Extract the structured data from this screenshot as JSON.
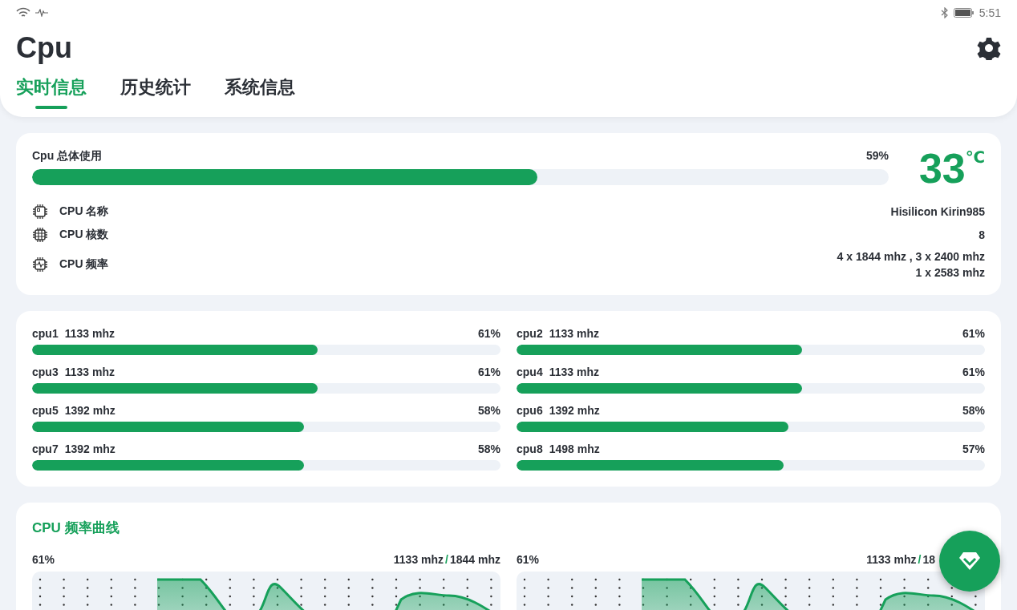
{
  "status_bar": {
    "time": "5:51"
  },
  "header": {
    "title": "Cpu"
  },
  "tabs": [
    {
      "label": "实时信息",
      "selected": true
    },
    {
      "label": "历史统计",
      "selected": false
    },
    {
      "label": "系统信息",
      "selected": false
    }
  ],
  "overview": {
    "usage_label": "Cpu 总体使用",
    "usage_reading": "59%",
    "level": 0.59,
    "temperature": "33",
    "temperature_unit": "℃",
    "info": [
      {
        "kind": "chip",
        "label": "CPU 名称",
        "values": [
          "Hisilicon Kirin985"
        ]
      },
      {
        "kind": "grid",
        "label": "CPU 核数",
        "values": [
          "8"
        ]
      },
      {
        "kind": "pulse",
        "label": "CPU 频率",
        "values": [
          "4 x 1844 mhz , 3 x 2400 mhz",
          "1 x 2583 mhz"
        ]
      }
    ]
  },
  "cores": [
    {
      "name": "cpu1",
      "freq": "1133 mhz",
      "reading": "61%",
      "level": 0.61
    },
    {
      "name": "cpu2",
      "freq": "1133 mhz",
      "reading": "61%",
      "level": 0.61
    },
    {
      "name": "cpu3",
      "freq": "1133 mhz",
      "reading": "61%",
      "level": 0.61
    },
    {
      "name": "cpu4",
      "freq": "1133 mhz",
      "reading": "61%",
      "level": 0.61
    },
    {
      "name": "cpu5",
      "freq": "1392 mhz",
      "reading": "58%",
      "level": 0.58
    },
    {
      "name": "cpu6",
      "freq": "1392 mhz",
      "reading": "58%",
      "level": 0.58
    },
    {
      "name": "cpu7",
      "freq": "1392 mhz",
      "reading": "58%",
      "level": 0.58
    },
    {
      "name": "cpu8",
      "freq": "1498 mhz",
      "reading": "57%",
      "level": 0.57
    }
  ],
  "curves": {
    "title": "CPU 频率曲线",
    "items": [
      {
        "reading": "61%",
        "current": "1133 mhz",
        "separator": "/",
        "max": "1844 mhz"
      },
      {
        "reading": "61%",
        "current": "1133 mhz",
        "separator": "/",
        "max": "18"
      }
    ]
  }
}
